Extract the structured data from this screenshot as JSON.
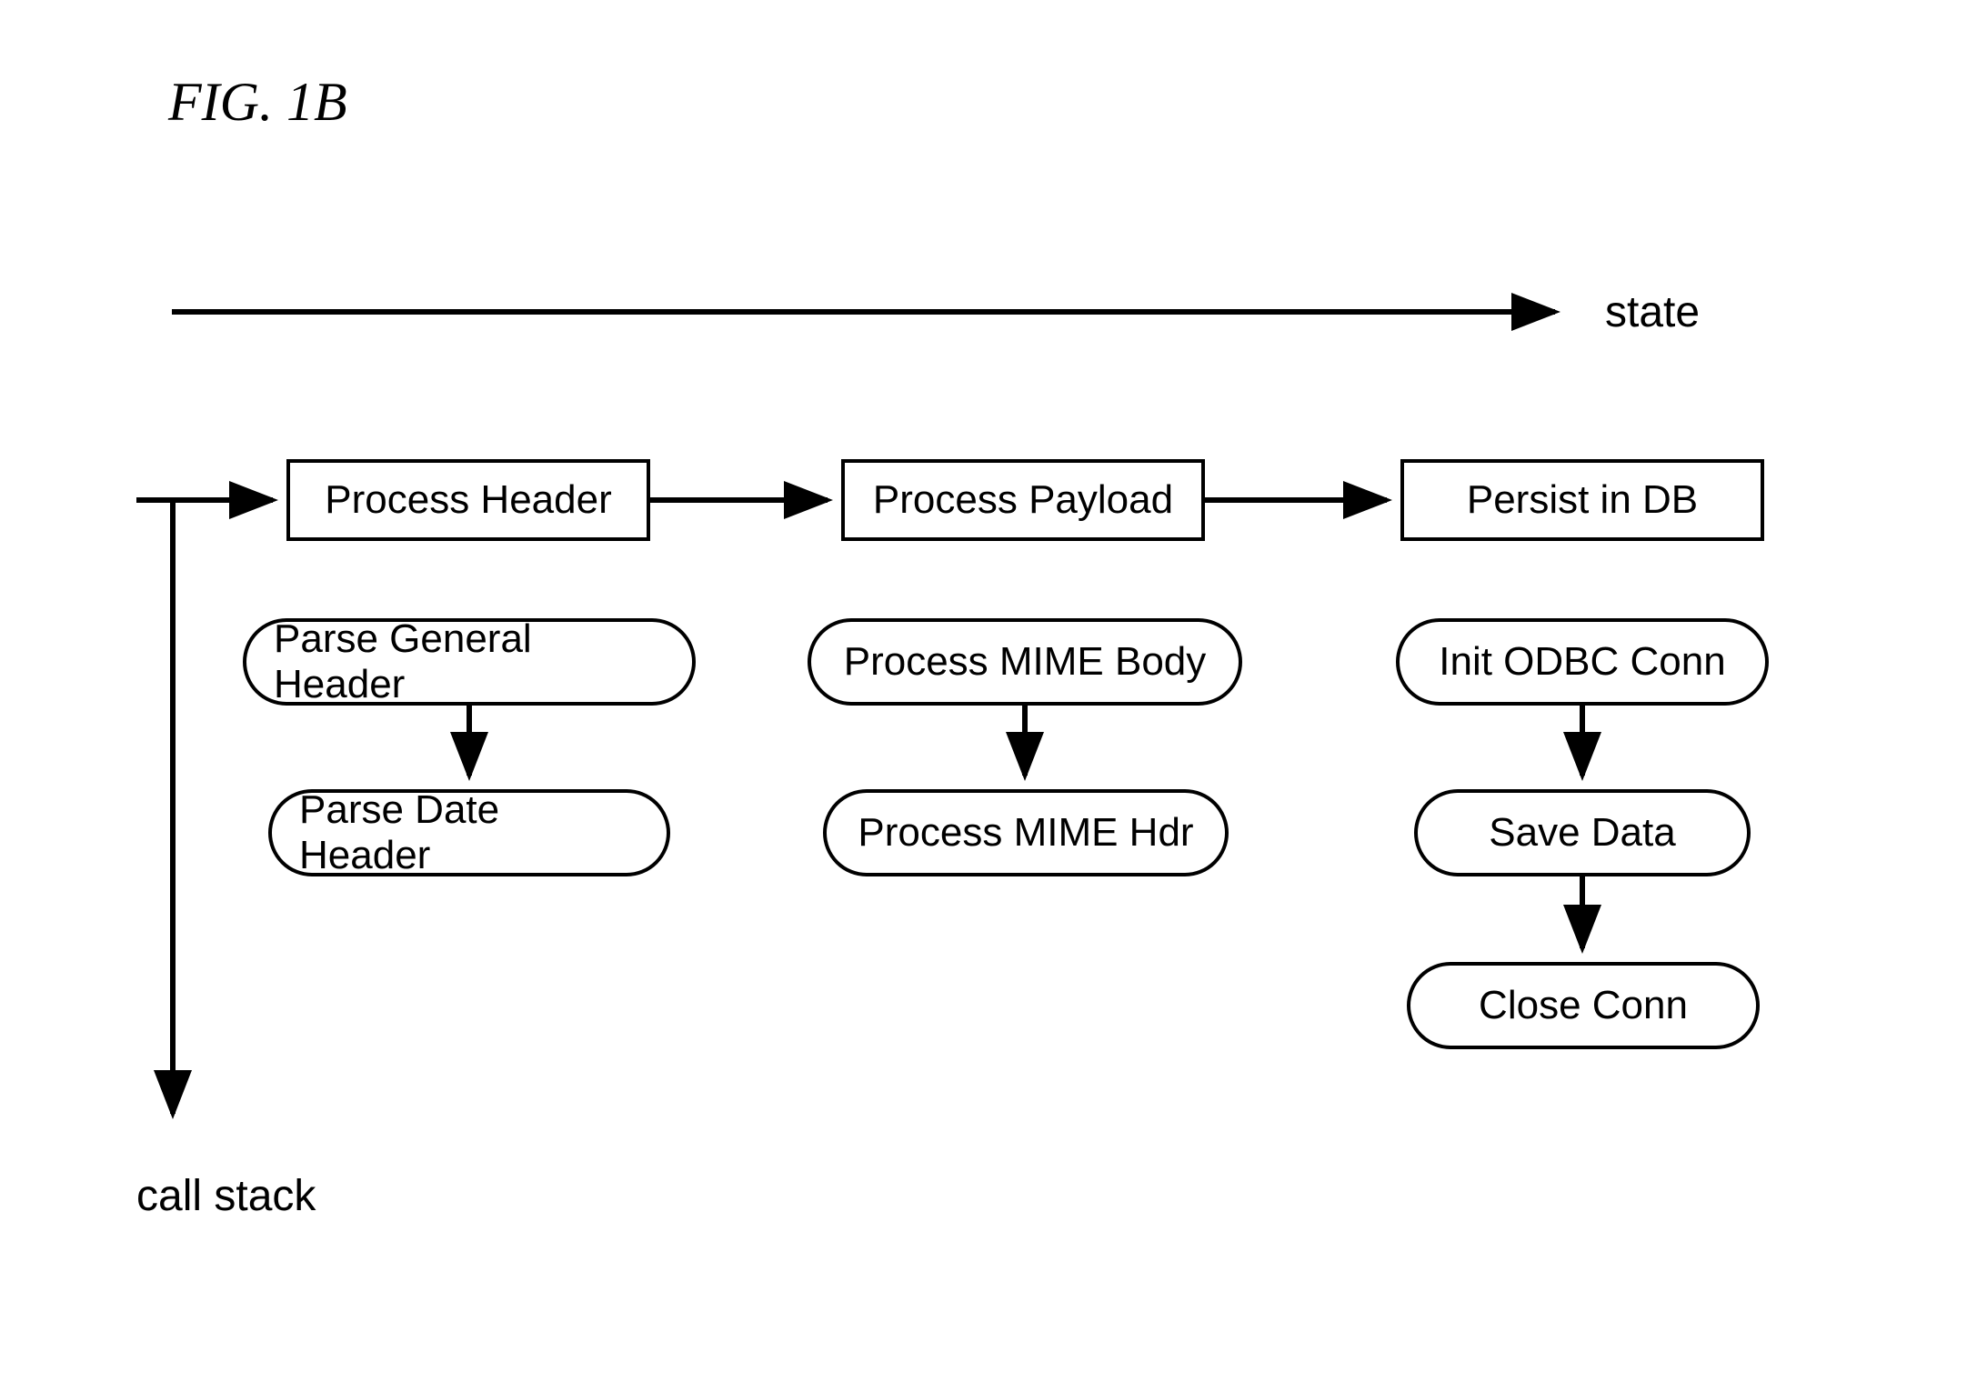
{
  "figure": {
    "title": "FIG. 1B",
    "axes": {
      "horizontal": "state",
      "vertical": "call stack"
    },
    "columns": [
      {
        "stage": "Process Header",
        "steps": [
          "Parse General Header",
          "Parse Date Header"
        ]
      },
      {
        "stage": "Process Payload",
        "steps": [
          "Process MIME Body",
          "Process MIME Hdr"
        ]
      },
      {
        "stage": "Persist in DB",
        "steps": [
          "Init ODBC Conn",
          "Save Data",
          "Close Conn"
        ]
      }
    ]
  }
}
